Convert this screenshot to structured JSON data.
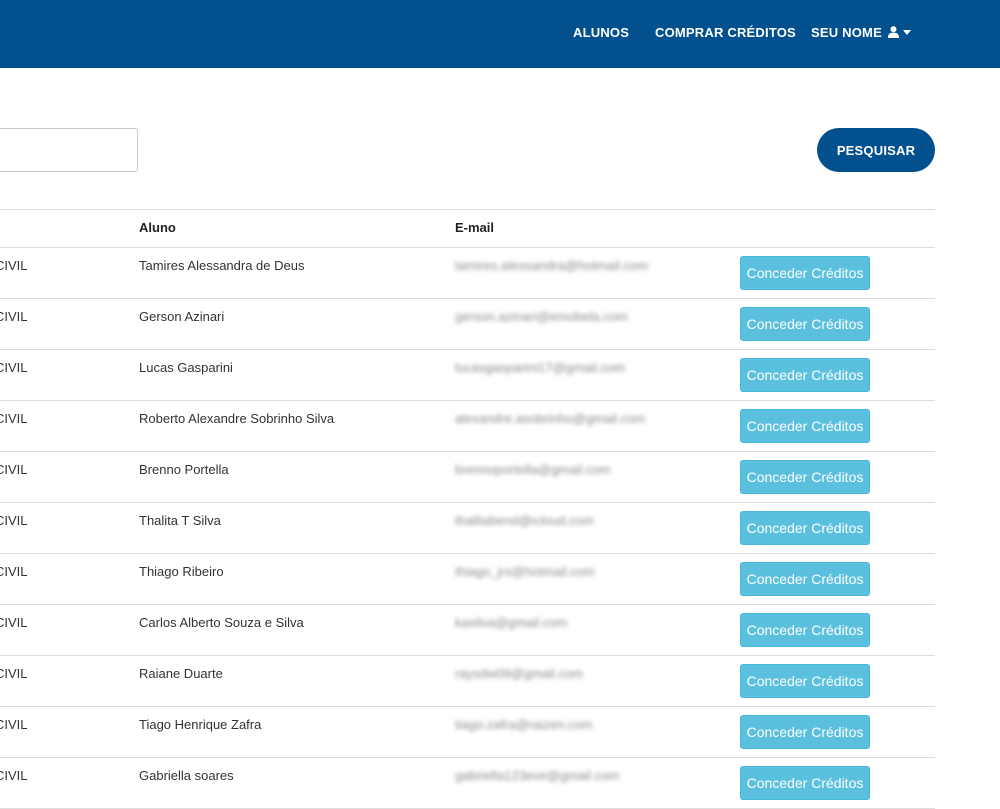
{
  "navbar": {
    "items": [
      "ALUNOS",
      "COMPRAR CRÉDITOS"
    ],
    "user_menu_label": "SEU NOME",
    "colors": {
      "background": "#03508f",
      "text": "#ffffff"
    }
  },
  "search": {
    "value": "",
    "button_label": "PESQUISAR"
  },
  "table": {
    "headers": {
      "curso": "",
      "aluno": "Aluno",
      "email": "E-mail"
    },
    "rows": [
      {
        "curso": "CIVIL",
        "aluno": "Tamires Alessandra de Deus",
        "email": "tamires.alessandra@hotmail.com",
        "action": "Conceder Créditos"
      },
      {
        "curso": "CIVIL",
        "aluno": "Gerson Azinari",
        "email": "gerson.azinari@emobela.com",
        "action": "Conceder Créditos"
      },
      {
        "curso": "CIVIL",
        "aluno": "Lucas Gasparini",
        "email": "lucasgasparini17@gmail.com",
        "action": "Conceder Créditos"
      },
      {
        "curso": "CIVIL",
        "aluno": "Roberto Alexandre Sobrinho Silva",
        "email": "alexandre.asobrinho@gmail.com",
        "action": "Conceder Créditos"
      },
      {
        "curso": "CIVIL",
        "aluno": "Brenno Portella",
        "email": "brennoportella@gmail.com",
        "action": "Conceder Créditos"
      },
      {
        "curso": "CIVIL",
        "aluno": "Thalita T Silva",
        "email": "thalitabend@icloud.com",
        "action": "Conceder Créditos"
      },
      {
        "curso": "CIVIL",
        "aluno": "Thiago Ribeiro",
        "email": "thiago_jrs@hotmail.com",
        "action": "Conceder Créditos"
      },
      {
        "curso": "CIVIL",
        "aluno": "Carlos Alberto Souza e Silva",
        "email": "kasilva@gmail.com",
        "action": "Conceder Créditos"
      },
      {
        "curso": "CIVIL",
        "aluno": "Raiane Duarte",
        "email": "raysdw09@gmail.com",
        "action": "Conceder Créditos"
      },
      {
        "curso": "CIVIL",
        "aluno": "Tiago Henrique Zafra",
        "email": "tiago.zafra@raizen.com",
        "action": "Conceder Créditos"
      },
      {
        "curso": "CIVIL",
        "aluno": "Gabriella soares",
        "email": "gabriella123eve@gmail.com",
        "action": "Conceder Créditos"
      }
    ],
    "button_color": "#5bc0de"
  },
  "icons": {
    "user": "user-icon",
    "dropdown": "chevron-down-icon"
  }
}
